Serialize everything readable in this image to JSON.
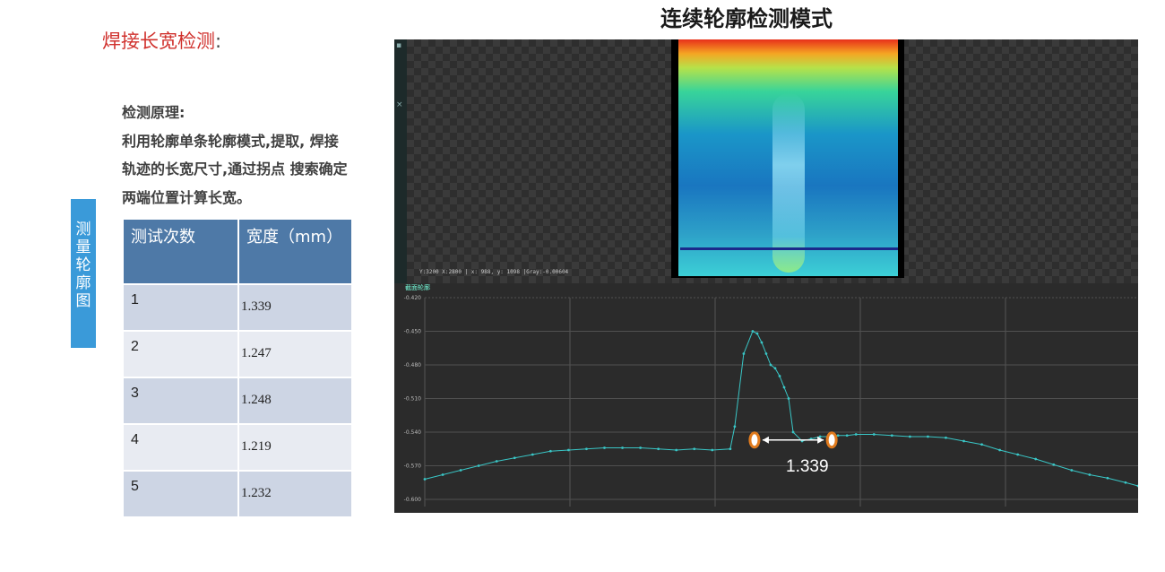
{
  "left_panel": {
    "section_title": "焊接长宽检测",
    "section_colon": ":",
    "principle_lines": [
      "检测原理:",
      "利用轮廓单条轮廓模式,提取, 焊接",
      "轨迹的长宽尺寸,通过拐点 搜索确定",
      "两端位置计算长宽。"
    ],
    "side_tab_chars": [
      "测",
      "量",
      "轮",
      "廓",
      "图"
    ]
  },
  "table": {
    "headers": [
      "测试次数",
      "宽度（mm）"
    ],
    "rows": [
      {
        "index": "1",
        "value": "1.339"
      },
      {
        "index": "2",
        "value": "1.247"
      },
      {
        "index": "3",
        "value": "1.248"
      },
      {
        "index": "4",
        "value": "1.219"
      },
      {
        "index": "5",
        "value": "1.232"
      }
    ]
  },
  "main_title": "连续轮廓检测模式",
  "screenshot": {
    "status_text": "Y:3200 X:2800 | x: 988, y: 1098 |Gray:-0.00604",
    "profile_tab": "截面轮廓",
    "measurement_label": "1.339"
  },
  "chart_data": {
    "type": "scatter",
    "ylim": [
      -0.6,
      -0.42
    ],
    "ytick_labels": [
      "-0.420",
      "-0.450",
      "-0.480",
      "-0.510",
      "-0.540",
      "-0.570",
      "-0.600"
    ],
    "grid": true,
    "series": [
      {
        "x": [
          0,
          20,
          40,
          60,
          80,
          100,
          120,
          140,
          160,
          180,
          200,
          220,
          240,
          260,
          280,
          300,
          320,
          340,
          345,
          355,
          365,
          370,
          375,
          380,
          385,
          390,
          395,
          400,
          405,
          410,
          420,
          430,
          440,
          450,
          460,
          470,
          480,
          500,
          520,
          540,
          560,
          580,
          600,
          620,
          640,
          660,
          680,
          700,
          720,
          740,
          760,
          780,
          794
        ],
        "y": [
          -0.582,
          -0.578,
          -0.574,
          -0.57,
          -0.566,
          -0.563,
          -0.56,
          -0.557,
          -0.556,
          -0.555,
          -0.554,
          -0.554,
          -0.554,
          -0.555,
          -0.556,
          -0.555,
          -0.556,
          -0.555,
          -0.535,
          -0.47,
          -0.45,
          -0.452,
          -0.46,
          -0.47,
          -0.48,
          -0.483,
          -0.49,
          -0.5,
          -0.51,
          -0.54,
          -0.548,
          -0.546,
          -0.544,
          -0.544,
          -0.543,
          -0.543,
          -0.542,
          -0.542,
          -0.543,
          -0.544,
          -0.544,
          -0.545,
          -0.548,
          -0.551,
          -0.556,
          -0.56,
          -0.564,
          -0.569,
          -0.574,
          -0.578,
          -0.581,
          -0.585,
          -0.588
        ],
        "color": "#39c6c6"
      }
    ],
    "markers": [
      {
        "x": 367
      },
      {
        "x": 453
      }
    ],
    "annotation": "1.339"
  }
}
